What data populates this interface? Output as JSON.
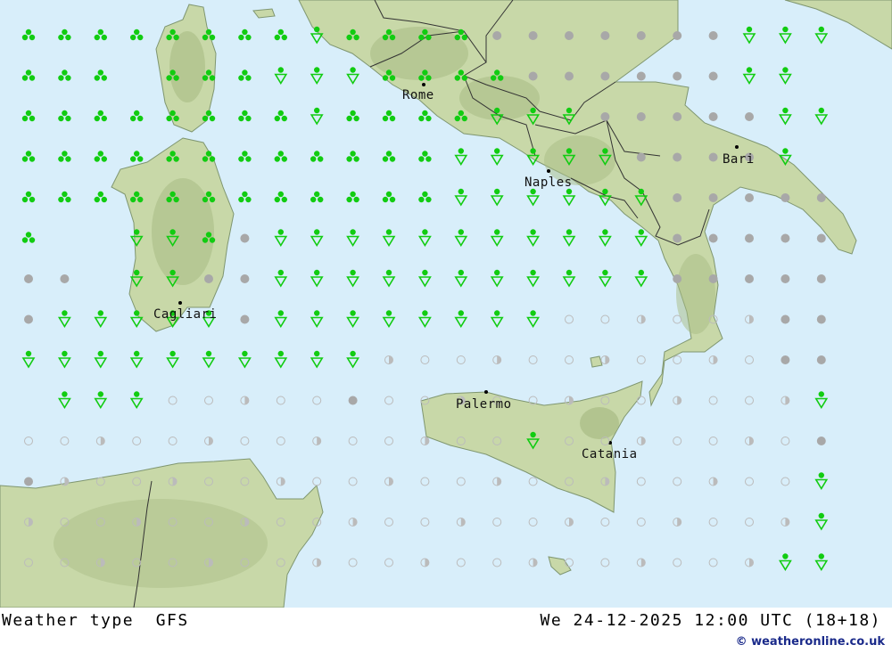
{
  "map": {
    "colors": {
      "sea": "#d8eefa",
      "land": "#c8d8a8",
      "land_high": "#a8bc84",
      "border": "#333333",
      "rain": "#11cc11",
      "cloud": "#a8a8a8",
      "partly": "#bbbbbb"
    },
    "cities": [
      {
        "name": "Rome"
      },
      {
        "name": "Naples"
      },
      {
        "name": "Bari"
      },
      {
        "name": "Cagliari"
      },
      {
        "name": "Palermo"
      },
      {
        "name": "Catania"
      }
    ],
    "symbol_grid": [
      "RRRRRRRRSRRRRCCCCCCCSSS",
      "RRR.RRRSSSRRRRCCCCCCSS.",
      "RRRRRRRRSRRRRSSSCCCCCSS",
      "RRRRRRRRRRRRSSSSSCCCCS.",
      "RRRRRRRRRRRRSSSSSSCCCCC",
      "R..SSRCSSSSSSSSSSSCCCCC",
      "CC.SSCCSSSSSSSSSSSCCCCC",
      "CSSSSSCSSSSSSSSPPPPPPCC",
      "SSSSSSSSSSPPPPPPPPPPPCC",
      ".SSSPPPPPCPPPPPPPPPPPPS",
      "PPPPPPPPPPPPPPSPPPPPPPC",
      "CPPPPPPPPPPPPPPPPPPPPPS",
      "PPPPPPPPPPPPPPPPPPPPPPS",
      "PPPPPPPPPPPPPPPPPPPPPSS"
    ]
  },
  "footer": {
    "title": "Weather type  GFS",
    "datetime": "We 24-12-2025 12:00 UTC (18+18)",
    "credit": "© weatheronline.co.uk"
  }
}
